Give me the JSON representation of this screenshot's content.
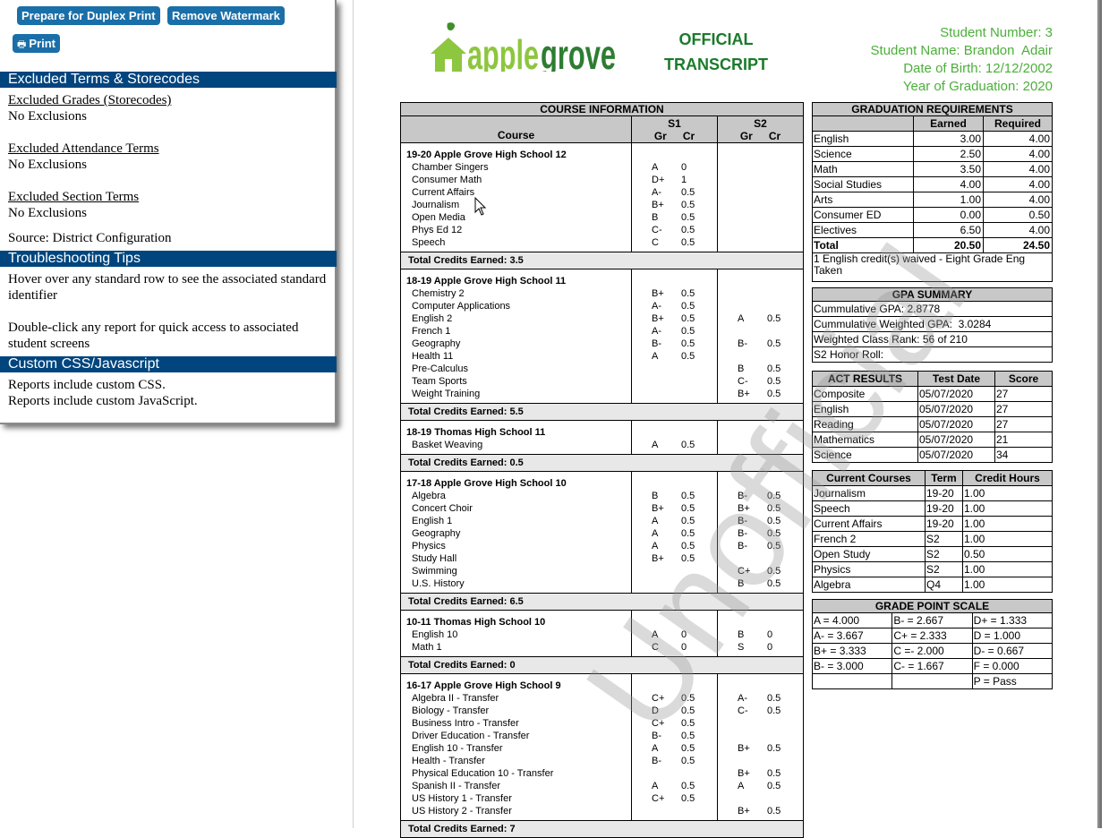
{
  "left_panel": {
    "buttons": {
      "duplex": "Prepare for Duplex Print",
      "remove_watermark": "Remove Watermark",
      "print": "Print"
    },
    "sections": {
      "excluded": {
        "title": "Excluded Terms & Storecodes",
        "grades_label": "Excluded Grades (Storecodes)",
        "grades_value": "No Exclusions",
        "attendance_label": "Excluded Attendance Terms",
        "attendance_value": "No Exclusions",
        "section_label": "Excluded Section Terms",
        "section_value": "No Exclusions",
        "source": "Source: District Configuration"
      },
      "troubleshooting": {
        "title": "Troubleshooting Tips",
        "tip1": "Hover over any standard row to see the associated standard identifier",
        "tip2": "Double-click any report for quick access to associated student screens"
      },
      "custom": {
        "title": "Custom CSS/Javascript",
        "line1": "Reports include custom CSS.",
        "line2": "Reports include custom JavaScript."
      }
    }
  },
  "header": {
    "logo_text_light": "apple",
    "logo_text_dark": "grove",
    "official_line1": "OFFICIAL",
    "official_line2": "TRANSCRIPT",
    "student_number": "Student Number: 3",
    "student_name": "Student Name: Brandon  Adair",
    "dob": "Date of Birth: 12/12/2002",
    "graduation_year": "Year of Graduation: 2020"
  },
  "watermark": "Unofficial",
  "course_info": {
    "title": "COURSE INFORMATION",
    "course_header": "Course",
    "s1": "S1",
    "s2": "S2",
    "gr": "Gr",
    "cr": "Cr",
    "blocks": [
      {
        "school": "19-20 Apple Grove High School 12",
        "total": "Total Credits Earned: 3.5",
        "courses": [
          {
            "name": "Chamber Singers",
            "s1_gr": "A",
            "s1_cr": "0",
            "s2_gr": "",
            "s2_cr": ""
          },
          {
            "name": "Consumer Math",
            "s1_gr": "D+",
            "s1_cr": "1",
            "s2_gr": "",
            "s2_cr": ""
          },
          {
            "name": "Current Affairs",
            "s1_gr": "A-",
            "s1_cr": "0.5",
            "s2_gr": "",
            "s2_cr": ""
          },
          {
            "name": "Journalism",
            "s1_gr": "B+",
            "s1_cr": "0.5",
            "s2_gr": "",
            "s2_cr": ""
          },
          {
            "name": "Open Media",
            "s1_gr": "B",
            "s1_cr": "0.5",
            "s2_gr": "",
            "s2_cr": ""
          },
          {
            "name": "Phys Ed 12",
            "s1_gr": "C-",
            "s1_cr": "0.5",
            "s2_gr": "",
            "s2_cr": ""
          },
          {
            "name": "Speech",
            "s1_gr": "C",
            "s1_cr": "0.5",
            "s2_gr": "",
            "s2_cr": ""
          }
        ]
      },
      {
        "school": "18-19 Apple Grove High School 11",
        "total": "Total Credits Earned: 5.5",
        "courses": [
          {
            "name": "Chemistry 2",
            "s1_gr": "B+",
            "s1_cr": "0.5",
            "s2_gr": "",
            "s2_cr": ""
          },
          {
            "name": "Computer Applications",
            "s1_gr": "A-",
            "s1_cr": "0.5",
            "s2_gr": "",
            "s2_cr": ""
          },
          {
            "name": "English 2",
            "s1_gr": "B+",
            "s1_cr": "0.5",
            "s2_gr": "A",
            "s2_cr": "0.5"
          },
          {
            "name": "French 1",
            "s1_gr": "A-",
            "s1_cr": "0.5",
            "s2_gr": "",
            "s2_cr": ""
          },
          {
            "name": "Geography",
            "s1_gr": "B-",
            "s1_cr": "0.5",
            "s2_gr": "B-",
            "s2_cr": "0.5"
          },
          {
            "name": "Health 11",
            "s1_gr": "A",
            "s1_cr": "0.5",
            "s2_gr": "",
            "s2_cr": ""
          },
          {
            "name": "Pre-Calculus",
            "s1_gr": "",
            "s1_cr": "",
            "s2_gr": "B",
            "s2_cr": "0.5"
          },
          {
            "name": "Team Sports",
            "s1_gr": "",
            "s1_cr": "",
            "s2_gr": "C-",
            "s2_cr": "0.5"
          },
          {
            "name": "Weight Training",
            "s1_gr": "",
            "s1_cr": "",
            "s2_gr": "B+",
            "s2_cr": "0.5"
          }
        ]
      },
      {
        "school": "18-19 Thomas High School 11",
        "total": "Total Credits Earned: 0.5",
        "courses": [
          {
            "name": "Basket Weaving",
            "s1_gr": "A",
            "s1_cr": "0.5",
            "s2_gr": "",
            "s2_cr": ""
          }
        ]
      },
      {
        "school": "17-18 Apple Grove High School 10",
        "total": "Total Credits Earned: 6.5",
        "courses": [
          {
            "name": "Algebra",
            "s1_gr": "B",
            "s1_cr": "0.5",
            "s2_gr": "B-",
            "s2_cr": "0.5"
          },
          {
            "name": "Concert Choir",
            "s1_gr": "B+",
            "s1_cr": "0.5",
            "s2_gr": "B+",
            "s2_cr": "0.5"
          },
          {
            "name": "English 1",
            "s1_gr": "A",
            "s1_cr": "0.5",
            "s2_gr": "B-",
            "s2_cr": "0.5"
          },
          {
            "name": "Geography",
            "s1_gr": "A",
            "s1_cr": "0.5",
            "s2_gr": "B-",
            "s2_cr": "0.5"
          },
          {
            "name": "Physics",
            "s1_gr": "A",
            "s1_cr": "0.5",
            "s2_gr": "B-",
            "s2_cr": "0.5"
          },
          {
            "name": "Study Hall",
            "s1_gr": "B+",
            "s1_cr": "0.5",
            "s2_gr": "",
            "s2_cr": ""
          },
          {
            "name": "Swimming",
            "s1_gr": "",
            "s1_cr": "",
            "s2_gr": "C+",
            "s2_cr": "0.5"
          },
          {
            "name": "U.S. History",
            "s1_gr": "",
            "s1_cr": "",
            "s2_gr": "B",
            "s2_cr": "0.5"
          }
        ]
      },
      {
        "school": "10-11 Thomas High School 10",
        "total": "Total Credits Earned: 0",
        "courses": [
          {
            "name": "English 10",
            "s1_gr": "A",
            "s1_cr": "0",
            "s2_gr": "B",
            "s2_cr": "0"
          },
          {
            "name": "Math 1",
            "s1_gr": "C",
            "s1_cr": "0",
            "s2_gr": "S",
            "s2_cr": "0"
          }
        ]
      },
      {
        "school": "16-17 Apple Grove High School 9",
        "total": "Total Credits Earned: 7",
        "courses": [
          {
            "name": "Algebra II - Transfer",
            "s1_gr": "C+",
            "s1_cr": "0.5",
            "s2_gr": "A-",
            "s2_cr": "0.5"
          },
          {
            "name": "Biology - Transfer",
            "s1_gr": "D",
            "s1_cr": "0.5",
            "s2_gr": "C-",
            "s2_cr": "0.5"
          },
          {
            "name": "Business Intro - Transfer",
            "s1_gr": "C+",
            "s1_cr": "0.5",
            "s2_gr": "",
            "s2_cr": ""
          },
          {
            "name": "Driver Education - Transfer",
            "s1_gr": "B-",
            "s1_cr": "0.5",
            "s2_gr": "",
            "s2_cr": ""
          },
          {
            "name": "English 10 - Transfer",
            "s1_gr": "A",
            "s1_cr": "0.5",
            "s2_gr": "B+",
            "s2_cr": "0.5"
          },
          {
            "name": "Health - Transfer",
            "s1_gr": "B-",
            "s1_cr": "0.5",
            "s2_gr": "",
            "s2_cr": ""
          },
          {
            "name": "Physical Education 10 - Transfer",
            "s1_gr": "",
            "s1_cr": "",
            "s2_gr": "B+",
            "s2_cr": "0.5"
          },
          {
            "name": "Spanish II - Transfer",
            "s1_gr": "A",
            "s1_cr": "0.5",
            "s2_gr": "A",
            "s2_cr": "0.5"
          },
          {
            "name": "US History 1 - Transfer",
            "s1_gr": "C+",
            "s1_cr": "0.5",
            "s2_gr": "",
            "s2_cr": ""
          },
          {
            "name": "US History 2 - Transfer",
            "s1_gr": "",
            "s1_cr": "",
            "s2_gr": "B+",
            "s2_cr": "0.5"
          }
        ]
      }
    ]
  },
  "graduation_requirements": {
    "title": "GRADUATION REQUIREMENTS",
    "earned_header": "Earned",
    "required_header": "Required",
    "rows": [
      {
        "subject": "English",
        "earned": "3.00",
        "required": "4.00"
      },
      {
        "subject": "Science",
        "earned": "2.50",
        "required": "4.00"
      },
      {
        "subject": "Math",
        "earned": "3.50",
        "required": "4.00"
      },
      {
        "subject": "Social Studies",
        "earned": "4.00",
        "required": "4.00"
      },
      {
        "subject": "Arts",
        "earned": "1.00",
        "required": "4.00"
      },
      {
        "subject": "Consumer ED",
        "earned": "0.00",
        "required": "0.50"
      },
      {
        "subject": "Electives",
        "earned": "6.50",
        "required": "4.00"
      }
    ],
    "total": {
      "subject": "Total",
      "earned": "20.50",
      "required": "24.50"
    },
    "note": "1 English credit(s) waived - Eight Grade Eng Taken"
  },
  "gpa_summary": {
    "title": "GPA SUMMARY",
    "lines": [
      "Cummulative GPA: 2.8778",
      "Cummulative Weighted GPA:  3.0284",
      "Weighted Class Rank: 56 of 210",
      "S2 Honor Roll:"
    ]
  },
  "act_results": {
    "headers": [
      "ACT RESULTS",
      "Test Date",
      "Score"
    ],
    "rows": [
      {
        "test": "Composite",
        "date": "05/07/2020",
        "score": "27"
      },
      {
        "test": "English",
        "date": "05/07/2020",
        "score": "27"
      },
      {
        "test": "Reading",
        "date": "05/07/2020",
        "score": "27"
      },
      {
        "test": "Mathematics",
        "date": "05/07/2020",
        "score": "21"
      },
      {
        "test": "Science",
        "date": "05/07/2020",
        "score": "34"
      }
    ]
  },
  "current_courses": {
    "headers": [
      "Current Courses",
      "Term",
      "Credit Hours"
    ],
    "rows": [
      {
        "course": "Journalism",
        "term": "19-20",
        "hours": "1.00"
      },
      {
        "course": "Speech",
        "term": "19-20",
        "hours": "1.00"
      },
      {
        "course": "Current Affairs",
        "term": "19-20",
        "hours": "1.00"
      },
      {
        "course": "French 2",
        "term": "S2",
        "hours": "1.00"
      },
      {
        "course": "Open Study",
        "term": "S2",
        "hours": "0.50"
      },
      {
        "course": "Physics",
        "term": "S2",
        "hours": "1.00"
      },
      {
        "course": "Algebra",
        "term": "Q4",
        "hours": "1.00"
      }
    ]
  },
  "grade_point_scale": {
    "title": "GRADE POINT SCALE",
    "rows": [
      [
        "A = 4.000",
        "B- = 2.667",
        "D+ = 1.333"
      ],
      [
        "A- = 3.667",
        "C+ = 2.333",
        "D = 1.000"
      ],
      [
        "B+ = 3.333",
        "C =- 2.000",
        "D- = 0.667"
      ],
      [
        "B- = 3.000",
        "C- = 1.667",
        "F = 0.000"
      ],
      [
        "",
        "",
        "P = Pass"
      ]
    ]
  },
  "colors": {
    "button_blue": "#1a6fa8",
    "section_header_blue": "#00457e",
    "official_green": "#1b7a2b",
    "student_info_green": "#4caf3a",
    "logo_light_green": "#8dc63f",
    "logo_dark_green": "#2e7d32",
    "table_header_gray": "#c8c8c8"
  }
}
